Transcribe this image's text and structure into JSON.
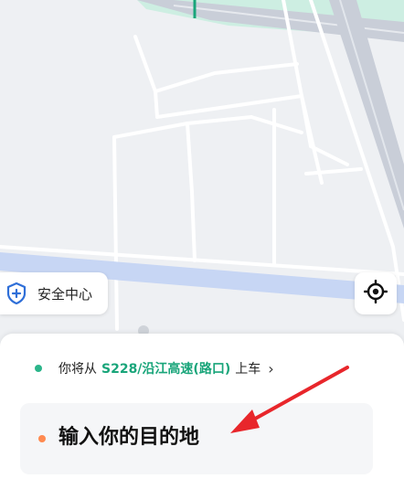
{
  "map": {
    "colors": {
      "land": "#eef0f3",
      "road": "#ffffff",
      "highway": "#c9ced8",
      "river": "#c7d6f4",
      "greenbelt": "#cdeee2",
      "route": "#19a57a"
    }
  },
  "safety_center": {
    "label": "安全中心",
    "icon": "shield-plus-icon"
  },
  "locate": {
    "icon": "locate-crosshair-icon"
  },
  "pickup": {
    "prefix": "你将从",
    "location": "S228/沿江高速(路口)",
    "suffix": "上车",
    "chevron": "›"
  },
  "destination": {
    "placeholder": "输入你的目的地"
  },
  "annotation": {
    "icon": "red-arrow-icon",
    "color": "#e8262b"
  }
}
